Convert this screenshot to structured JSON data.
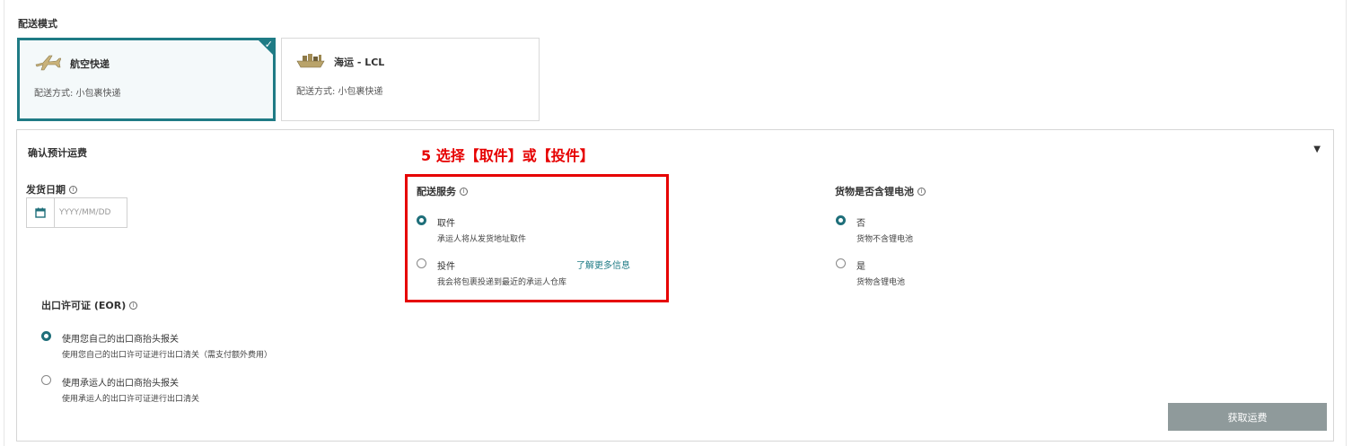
{
  "section": {
    "title": "配送模式"
  },
  "modes": [
    {
      "name": "航空快递",
      "desc": "配送方式: 小包裹快递",
      "icon": "airplane-icon",
      "selected": true
    },
    {
      "name": "海运 - LCL",
      "desc": "配送方式: 小包裹快递",
      "icon": "cargo-ship-icon",
      "selected": false
    }
  ],
  "panel": {
    "title": "确认预计运费",
    "annotation": "5 选择【取件】或【投件】",
    "ship_date": {
      "label": "发货日期",
      "placeholder": "YYYY/MM/DD"
    },
    "delivery_service": {
      "label": "配送服务",
      "options": [
        {
          "label": "取件",
          "desc": "承运人将从发货地址取件",
          "selected": true
        },
        {
          "label": "投件",
          "desc": "我会将包裹投递到最近的承运人仓库",
          "selected": false
        }
      ],
      "learn_more": "了解更多信息"
    },
    "battery": {
      "label": "货物是否含锂电池",
      "options": [
        {
          "label": "否",
          "desc": "货物不含锂电池",
          "selected": true
        },
        {
          "label": "是",
          "desc": "货物含锂电池",
          "selected": false
        }
      ]
    },
    "export_license": {
      "label": "出口许可证 (EOR)",
      "options": [
        {
          "label": "使用您自己的出口商抬头报关",
          "desc": "使用您自己的出口许可证进行出口清关（需支付额外费用）",
          "selected": true
        },
        {
          "label": "使用承运人的出口商抬头报关",
          "desc": "使用承运人的出口许可证进行出口清关",
          "selected": false
        }
      ]
    },
    "quote_button": "获取运费"
  },
  "colors": {
    "accent": "#1f7b85",
    "annotation_red": "#e60000",
    "button_disabled": "#8f9a9b"
  }
}
